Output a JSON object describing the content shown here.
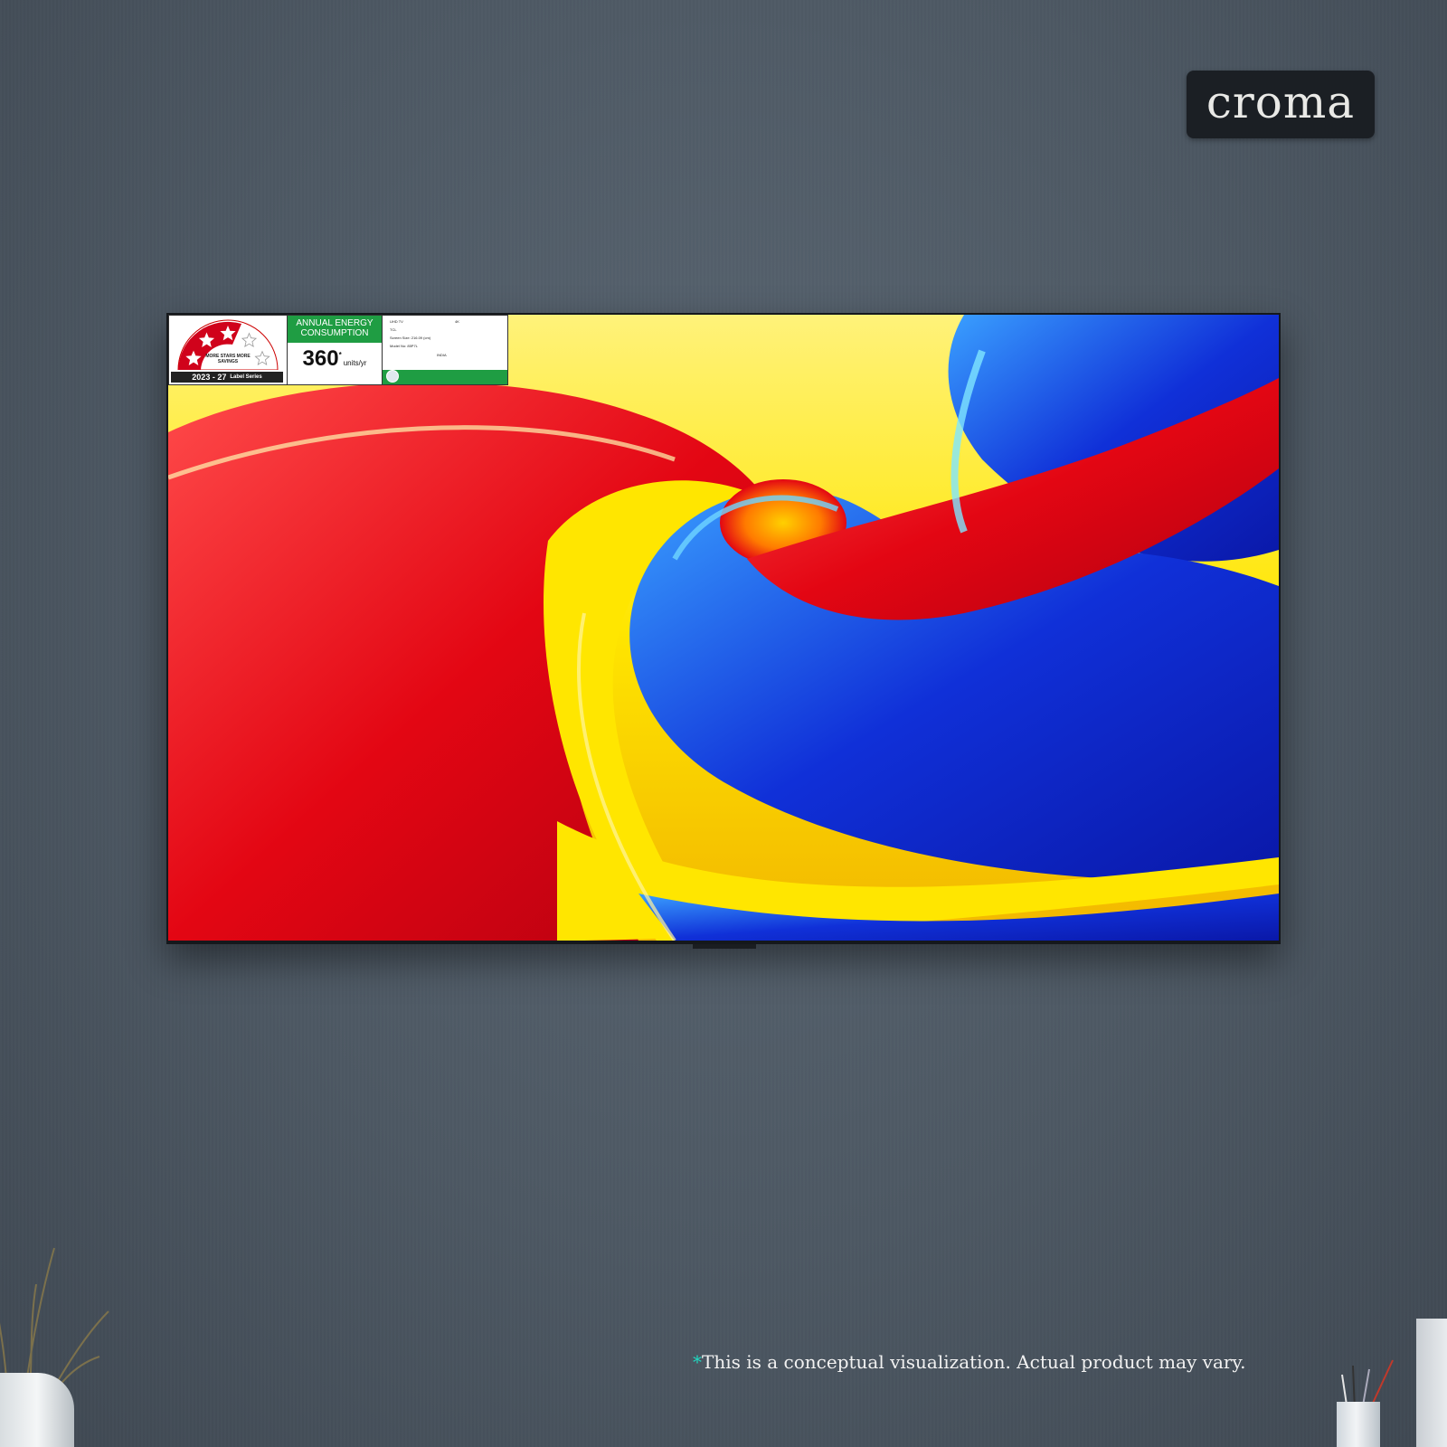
{
  "brand": {
    "logo": "croma"
  },
  "energy_label": {
    "heading": "ANNUAL ENERGY CONSUMPTION",
    "value": "360",
    "value_mark": "*",
    "unit": "units/yr",
    "stars_text": "MORE STARS MORE SAVINGS",
    "series_year": "2023 - 27",
    "series_text": "Label Series",
    "details": {
      "type": "UHD TV",
      "resolution": "4K",
      "brand": "TCL",
      "screen_size": "Screen Size: 216.09 (cm)",
      "model": "Model No: 85P7L",
      "country": "INDIA"
    },
    "star_rating": 3,
    "max_stars": 5
  },
  "disclaimer": {
    "mark": "*",
    "text": "This is a conceptual visualization. Actual product may vary."
  },
  "colors": {
    "wall": "#4d5863",
    "accent_asterisk": "#21d8c0",
    "label_green": "#1f9d43",
    "swirl_red": "#e30613",
    "swirl_yellow": "#ffe600",
    "swirl_blue": "#1030d8"
  }
}
